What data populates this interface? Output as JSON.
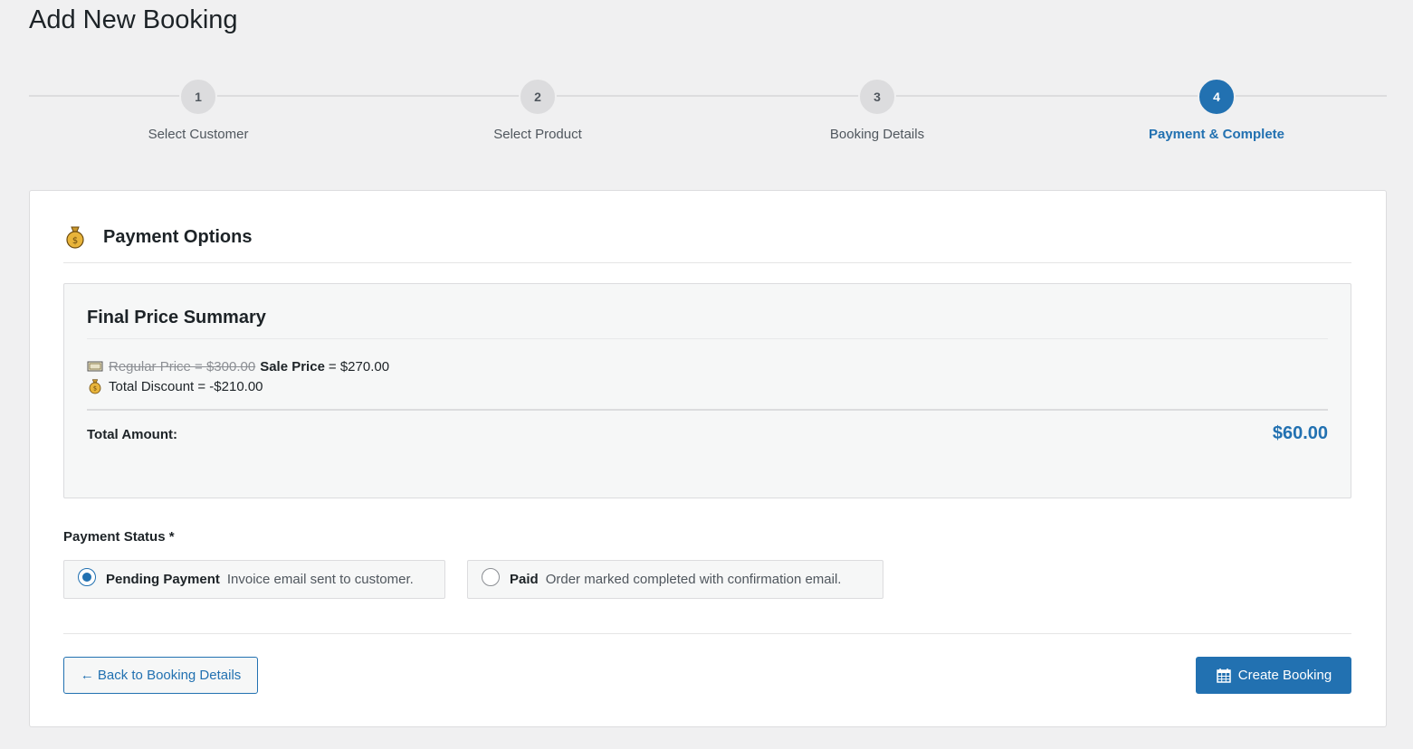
{
  "page": {
    "title": "Add New Booking"
  },
  "stepper": {
    "steps": [
      {
        "number": "1",
        "label": "Select Customer",
        "active": false
      },
      {
        "number": "2",
        "label": "Select Product",
        "active": false
      },
      {
        "number": "3",
        "label": "Booking Details",
        "active": false
      },
      {
        "number": "4",
        "label": "Payment & Complete",
        "active": true
      }
    ]
  },
  "payment": {
    "section_icon": "money-bag-icon",
    "section_title": "Payment Options",
    "summary": {
      "title": "Final Price Summary",
      "price_icon": "price-tag-icon",
      "regular_price": "Regular Price = $300.00",
      "sale_price_label": "Sale Price",
      "sale_price_value": "= $270.00",
      "discount_icon": "money-bag-icon",
      "discount": "Total Discount = -$210.00",
      "total_label": "Total Amount:",
      "total_value": "$60.00"
    },
    "status": {
      "label": "Payment Status *",
      "options": [
        {
          "title": "Pending Payment",
          "description": "Invoice email sent to customer.",
          "checked": true
        },
        {
          "title": "Paid",
          "description": "Order marked completed with confirmation email.",
          "checked": false
        }
      ]
    }
  },
  "actions": {
    "back_label": "← Back to Booking Details",
    "create_icon": "calendar-icon",
    "create_label": "Create Booking"
  },
  "colors": {
    "primary": "#2271b1",
    "background": "#f0f0f1",
    "step_inactive": "#dcdcde"
  }
}
